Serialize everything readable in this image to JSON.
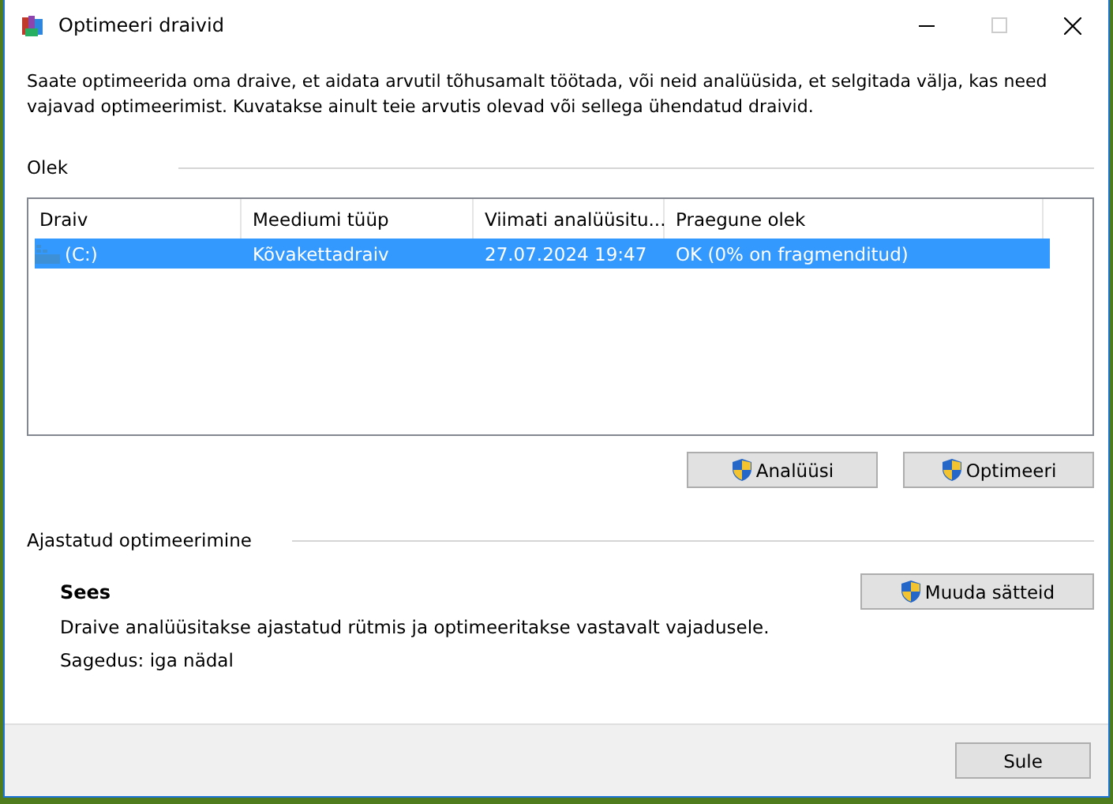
{
  "window": {
    "title": "Optimeeri draivid"
  },
  "description": "Saate optimeerida oma draive, et aidata arvutil tõhusamalt töötada, või neid analüüsida, et selgitada välja, kas need vajavad optimeerimist. Kuvatakse ainult teie arvutis olevad või sellega ühendatud draivid.",
  "status_section": {
    "title": "Olek",
    "table": {
      "columns": [
        "Draiv",
        "Meediumi tüüp",
        "Viimati analüüsitu...",
        "Praegune olek"
      ],
      "rows": [
        {
          "cells": [
            "(C:)",
            "Kõvakettadraiv",
            "27.07.2024 19:47",
            "OK (0% on fragmenditud)"
          ],
          "selected": true
        }
      ]
    },
    "buttons": [
      "Analüüsi",
      "Optimeeri"
    ]
  },
  "schedule_section": {
    "title": "Ajastatud optimeerimine",
    "state": "Sees",
    "button": "Muuda sätteid",
    "description": "Draive analüüsitakse ajastatud rütmis ja optimeeritakse vastavalt vajadusele.",
    "frequency": "Sagedus: iga nädal"
  },
  "footer": {
    "button": "Sule"
  }
}
